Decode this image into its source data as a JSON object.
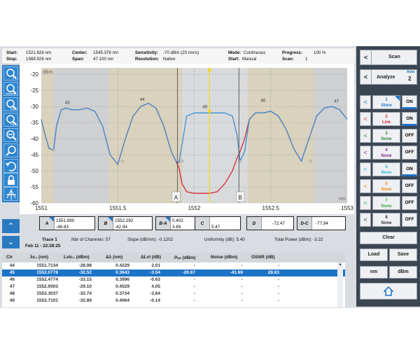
{
  "header": {
    "start_label": "Start:",
    "start_value": "1521.826 nm",
    "stop_label": "Stop:",
    "stop_value": "1568.926 nm",
    "center_label": "Center:",
    "center_value": "1545.376 nm",
    "span_label": "Span:",
    "span_value": "47.100 nm",
    "sensitivity_label": "Sensitivity:",
    "sensitivity_value": "-70 dBm (20 nm/s)",
    "resolution_label": "Resolution:",
    "resolution_value": "Native",
    "mode_label": "Mode:",
    "mode_value": "Continuous",
    "startmode_label": "Start:",
    "startmode_value": "Manual",
    "progress_label": "Progress:",
    "progress_value": "100 %",
    "scan_label": "Scan:",
    "scan_value": "1"
  },
  "left_toolbar": {
    "icons": [
      "zoom-area-icon",
      "zoom-in-icon",
      "zoom-auto-icon",
      "zoom-auto-icon",
      "zoom-out-icon",
      "zoom-fit-icon",
      "undo-zoom-icon",
      "lock-icon",
      "marker-peak-icon"
    ],
    "labels": [
      "1:1",
      "",
      "Auto",
      "Auto",
      "",
      "",
      "",
      "",
      ""
    ]
  },
  "chart": {
    "unit_y": "dBm",
    "unit_x": "nm",
    "y_ticks": [
      "-20",
      "-25",
      "-30",
      "-35",
      "-40",
      "-45",
      "-50",
      "-55",
      "-60"
    ],
    "x_ticks": [
      "1551",
      "1551.5",
      "1552",
      "1552.5",
      "1553"
    ],
    "marker_a": "A",
    "marker_b": "B",
    "peak_labels": [
      "43",
      "44",
      "45",
      "46",
      "47"
    ],
    "colors": {
      "blue_trace": "#3f8fd4",
      "red_trace": "#d8282f",
      "band": "#d9d2bc",
      "gray": "#cfd0d2",
      "cursor": "#f0d81c"
    }
  },
  "chart_data": {
    "type": "line",
    "xlabel": "nm",
    "ylabel": "dBm",
    "xlim": [
      1551,
      1553
    ],
    "ylim": [
      -60,
      -18
    ],
    "series": [
      {
        "x": [
          1551.0,
          1551.02,
          1551.05,
          1551.08,
          1551.1,
          1551.13,
          1551.16,
          1551.2,
          1551.25,
          1551.3,
          1551.35,
          1551.4,
          1551.45,
          1551.5,
          1551.55,
          1551.6,
          1551.65,
          1551.7,
          1551.75,
          1551.8,
          1551.85,
          1551.88,
          1551.9,
          1551.92,
          1551.95,
          1552.0,
          1552.05,
          1552.1,
          1552.15,
          1552.2,
          1552.25,
          1552.28,
          1552.3,
          1552.33,
          1552.36,
          1552.4,
          1552.45,
          1552.5,
          1552.55,
          1552.6,
          1552.65,
          1552.7,
          1552.75,
          1552.8,
          1552.85,
          1552.9,
          1552.95,
          1553.0
        ],
        "values": [
          -34,
          -38,
          -43,
          -43.5,
          -36,
          -31,
          -30.5,
          -31,
          -31,
          -30.5,
          -31.5,
          -36,
          -45,
          -48,
          -40,
          -33,
          -30,
          -29,
          -30.5,
          -36,
          -44,
          -47,
          -47.5,
          -42,
          -33,
          -32,
          -32,
          -32,
          -32,
          -32,
          -33,
          -39,
          -47,
          -44,
          -34,
          -32,
          -32,
          -31.5,
          -33,
          -37,
          -43,
          -47,
          -40,
          -33,
          -30.5,
          -30,
          -31,
          -34
        ]
      },
      {
        "x": [
          1551.0,
          1551.02,
          1551.05,
          1551.08,
          1551.1,
          1551.13,
          1551.16,
          1551.2,
          1551.25,
          1551.3,
          1551.35,
          1551.4,
          1551.45,
          1551.5,
          1551.55,
          1551.6,
          1551.65,
          1551.7,
          1551.75,
          1551.8,
          1551.85,
          1551.88,
          1551.9,
          1551.92,
          1551.95,
          1552.0,
          1552.05,
          1552.1,
          1552.15,
          1552.2,
          1552.25,
          1552.28,
          1552.3,
          1552.33,
          1552.36,
          1552.4,
          1552.45,
          1552.5,
          1552.55,
          1552.6,
          1552.65,
          1552.7,
          1552.75,
          1552.8,
          1552.85,
          1552.9,
          1552.95,
          1553.0
        ],
        "values": [
          -34,
          -38,
          -43,
          -43.5,
          -36,
          -31,
          -30.5,
          -31,
          -31,
          -30.5,
          -31.5,
          -36,
          -45,
          -48,
          -40,
          -33,
          -30,
          -29,
          -30.5,
          -36,
          -44,
          -47,
          -49,
          -54,
          -56.5,
          -57,
          -57,
          -57,
          -56.5,
          -54,
          -50,
          -46,
          -44,
          -40,
          -34,
          -32,
          -32,
          -31.5,
          -33,
          -37,
          -43,
          -47,
          -40,
          -33,
          -30.5,
          -30,
          -31,
          -34
        ]
      }
    ]
  },
  "markers": {
    "a_label": "A",
    "a_value1": "1551.890",
    "a_value2": "-46.83",
    "b_label": "B",
    "b_value1": "1552.292",
    "b_value2": "-42.94",
    "ba_label": "B-A",
    "ba_value1": "0.402",
    "ba_value2": "3.89",
    "c_label": "C",
    "c_value": "5.47",
    "d_label": "D",
    "d_value": "-72.47",
    "dc_label": "D-C",
    "dc_value": "-77.94"
  },
  "trace_info": {
    "trace": "Trace 1",
    "date": "Feb 11 - 22:28:25",
    "channels": "Nbr of Channels: 57",
    "slope": "Slope (dB/nm): -0.1202",
    "uniformity": "Uniformity (dB): 5.40",
    "total_power": "Total Power (dBm): -3.22"
  },
  "table": {
    "headers": [
      "Ch",
      "λc₀ (nm)",
      "Lvlc₀ (dBm)",
      "Δλ (nm)",
      "ΔLvl (dB)",
      "Pᵢₙₜ (dBm)",
      "Noise (dBm)",
      "OSNR (dB)"
    ],
    "rows": [
      [
        "44",
        "1551.7134",
        "-28.98",
        "0.4229",
        "2.01",
        "-",
        "-",
        "-"
      ],
      [
        "45",
        "1552.0778",
        "-32.52",
        "0.3643",
        "-3.54",
        "-20.67",
        "-41.69",
        "28.83"
      ],
      [
        "46",
        "1552.4774",
        "-33.15",
        "0.3996",
        "-0.63",
        "-",
        "-",
        "-"
      ],
      [
        "47",
        "1552.9303",
        "-29.10",
        "0.4529",
        "4.05",
        "-",
        "-",
        "-"
      ],
      [
        "48",
        "1553.3037",
        "-32.74",
        "0.3734",
        "-3.64",
        "-",
        "-",
        "-"
      ],
      [
        "49",
        "1553.7101",
        "-32.89",
        "0.4064",
        "-0.14",
        "-",
        "-",
        "-"
      ]
    ]
  },
  "right_panel": {
    "scan_label": "Scan",
    "analyze_label": "Analyze",
    "analyze_num": "2",
    "analyze_auto": "Auto",
    "traces": [
      {
        "num": "1",
        "mode": "Store",
        "state": "ON",
        "color": "#1c73c7"
      },
      {
        "num": "2",
        "mode": "Live",
        "state": "ON",
        "color": "#d8282f"
      },
      {
        "num": "3",
        "mode": "None",
        "state": "OFF",
        "color": "#2f8a3a"
      },
      {
        "num": "4",
        "mode": "None",
        "state": "OFF",
        "color": "#8a2c8e"
      },
      {
        "num": "5",
        "mode": "None",
        "state": "ON",
        "color": "#2fb8d8"
      },
      {
        "num": "6",
        "mode": "None",
        "state": "OFF",
        "color": "#f08a1c"
      },
      {
        "num": "7",
        "mode": "None",
        "state": "OFF",
        "color": "#3aa84a"
      },
      {
        "num": "8",
        "mode": "None",
        "state": "OFF",
        "color": "#333333"
      }
    ],
    "clear_label": "Clear",
    "load_label": "Load",
    "save_label": "Save",
    "nm_label": "nm",
    "dbm_label": "dBm",
    "home_icon": "home-icon"
  }
}
